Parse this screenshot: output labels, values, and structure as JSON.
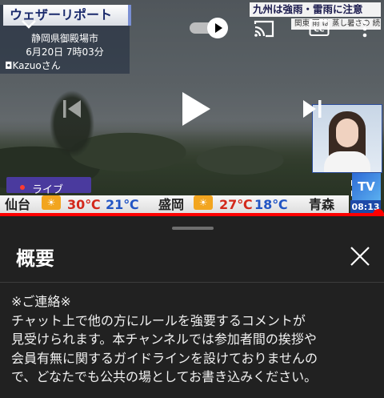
{
  "video": {
    "overlay": {
      "report_title": "ウェザーリポート",
      "location": "静岡県御殿場市",
      "datetime": "6月20日 7時03分",
      "reporter": "Kazuoさん"
    },
    "ticker": {
      "headline": "九州は強雨・雷雨に注意",
      "subline": "関東 雨 は 蒸し暑さの 続け"
    },
    "live_label": "ライブ",
    "tv_badge": "TV",
    "time_badge": "08:13",
    "weather_strip": [
      {
        "city": "仙台",
        "icon": "sun-icon",
        "high": "30℃",
        "low": "21℃"
      },
      {
        "city": "盛岡",
        "icon": "sun-icon",
        "high": "27℃",
        "low": "18℃"
      },
      {
        "city": "青森",
        "icon": "sun-icon",
        "high": "",
        "low": ""
      }
    ],
    "progress": 0.985,
    "icons": [
      "chevron-down-icon",
      "autoplay-toggle",
      "cast-icon",
      "cc-icon",
      "more-vert-icon",
      "previous-icon",
      "play-icon",
      "next-icon",
      "fullscreen-icon"
    ]
  },
  "sheet": {
    "title": "概要",
    "description_lines": [
      "※ご連絡※",
      "チャット上で他の方にルールを強要するコメントが",
      "見受けられます。本チャンネルでは参加者間の挨拶や",
      "会員有無に関するガイドラインを設けておりませんの",
      "で、どなたでも公共の場としてお書き込みください。"
    ]
  },
  "colors": {
    "accent": "#ff0000",
    "background": "#212121",
    "title_navy": "#1a2a6c"
  }
}
